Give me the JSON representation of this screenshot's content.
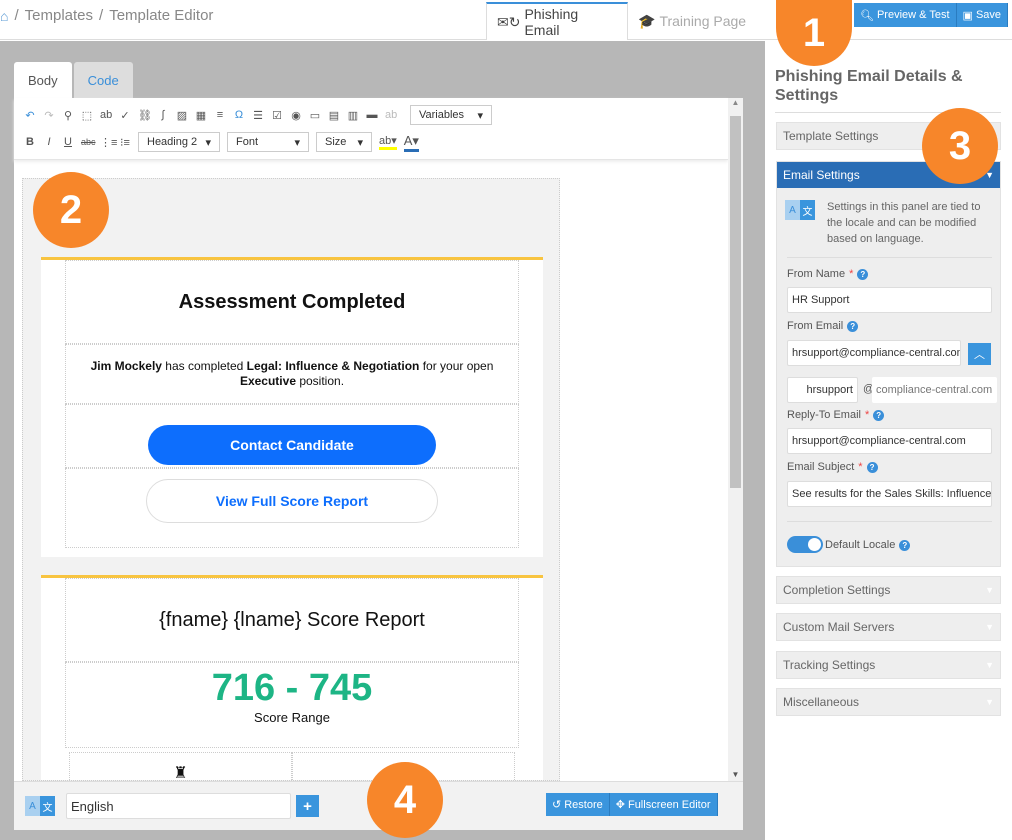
{
  "breadcrumb": {
    "items": [
      "Templates",
      "Template Editor"
    ],
    "home_icon": "home-icon"
  },
  "top_tabs": [
    {
      "label": "Phishing Email",
      "active": true
    },
    {
      "label": "Training Page",
      "active": false
    }
  ],
  "actions": {
    "preview": "Preview & Test",
    "save": "Save"
  },
  "editor": {
    "tabs": [
      "Body",
      "Code"
    ],
    "variables": "Variables",
    "heading": "Heading 2",
    "font": "Font",
    "size": "Size"
  },
  "email": {
    "title": "Assessment Completed",
    "name": "Jim Mockely",
    "t1": " has completed ",
    "course": "Legal: Influence & Negotiation",
    "t2": " for your open ",
    "role": "Executive",
    "t3": " position.",
    "contact": "Contact Candidate",
    "view": "View Full Score Report",
    "report_title": "{fname} {lname} Score Report",
    "score": "716 - 745",
    "score_label": "Score Range"
  },
  "footer": {
    "locale": "English",
    "add": "+",
    "restore": "Restore",
    "fullscreen": "Fullscreen Editor"
  },
  "sidebar": {
    "title": "Phishing Email Details & Settings",
    "template_settings": "Template Settings",
    "email_settings": "Email Settings",
    "note": "Settings in this panel are tied to the locale and can be modified based on language.",
    "from_name_label": "From Name",
    "from_name": "HR Support",
    "from_email_label": "From Email",
    "from_email": "hrsupport@compliance-central.com",
    "user": "hrsupport",
    "at": "@",
    "domain": "compliance-central.com",
    "reply_label": "Reply-To Email",
    "reply": "hrsupport@compliance-central.com",
    "subject_label": "Email Subject",
    "subject": "See results for the Sales Skills: Influence",
    "default_locale": "Default Locale",
    "sections": [
      "Completion Settings",
      "Custom Mail Servers",
      "Tracking Settings",
      "Miscellaneous"
    ]
  },
  "callouts": [
    "1",
    "2",
    "3",
    "4"
  ],
  "colors": {
    "accent": "#3a95dd",
    "panel_header": "#2a6db5",
    "callout": "#f7862a",
    "score": "#1db585",
    "button": "#0d6efd"
  }
}
